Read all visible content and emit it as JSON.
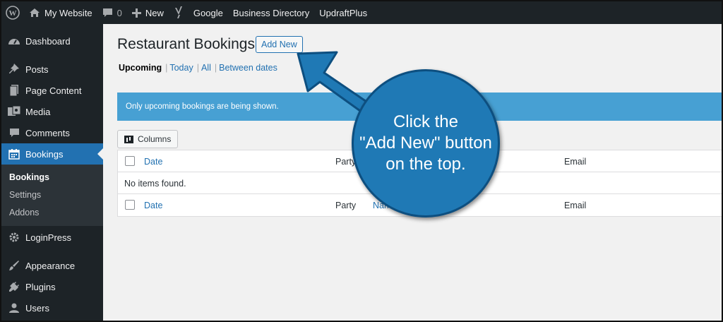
{
  "adminbar": {
    "site_name": "My Website",
    "comments_count": "0",
    "new_label": "New",
    "links": [
      "Google",
      "Business Directory",
      "UpdraftPlus"
    ]
  },
  "sidebar": {
    "items": [
      {
        "label": "Dashboard",
        "icon": "dashboard-icon"
      },
      {
        "label": "Posts",
        "icon": "pin-icon"
      },
      {
        "label": "Page Content",
        "icon": "page-icon"
      },
      {
        "label": "Media",
        "icon": "media-icon"
      },
      {
        "label": "Comments",
        "icon": "comment-icon"
      },
      {
        "label": "Bookings",
        "icon": "calendar-icon"
      },
      {
        "label": "LoginPress",
        "icon": "gear-icon"
      },
      {
        "label": "Appearance",
        "icon": "brush-icon"
      },
      {
        "label": "Plugins",
        "icon": "plug-icon"
      },
      {
        "label": "Users",
        "icon": "user-icon"
      }
    ],
    "submenu": [
      "Bookings",
      "Settings",
      "Addons"
    ]
  },
  "main": {
    "title": "Restaurant Bookings",
    "add_new": "Add New",
    "views": {
      "upcoming": "Upcoming",
      "today": "Today",
      "all": "All",
      "between": "Between dates",
      "separator": "|"
    },
    "notice": "Only upcoming bookings are being shown.",
    "columns_button": "Columns",
    "table": {
      "headers": {
        "date": "Date",
        "party": "Party",
        "name": "Name",
        "email": "Email"
      },
      "empty": "No items found."
    }
  },
  "callout": {
    "lines": [
      "Click the",
      "\"Add New\" button",
      "on the top."
    ],
    "color": "#1f79b5"
  },
  "colors": {
    "adminbar_bg": "#1d2327",
    "active_menu": "#2271b1",
    "notice_bg": "#47a0d3",
    "link": "#2271b1"
  }
}
